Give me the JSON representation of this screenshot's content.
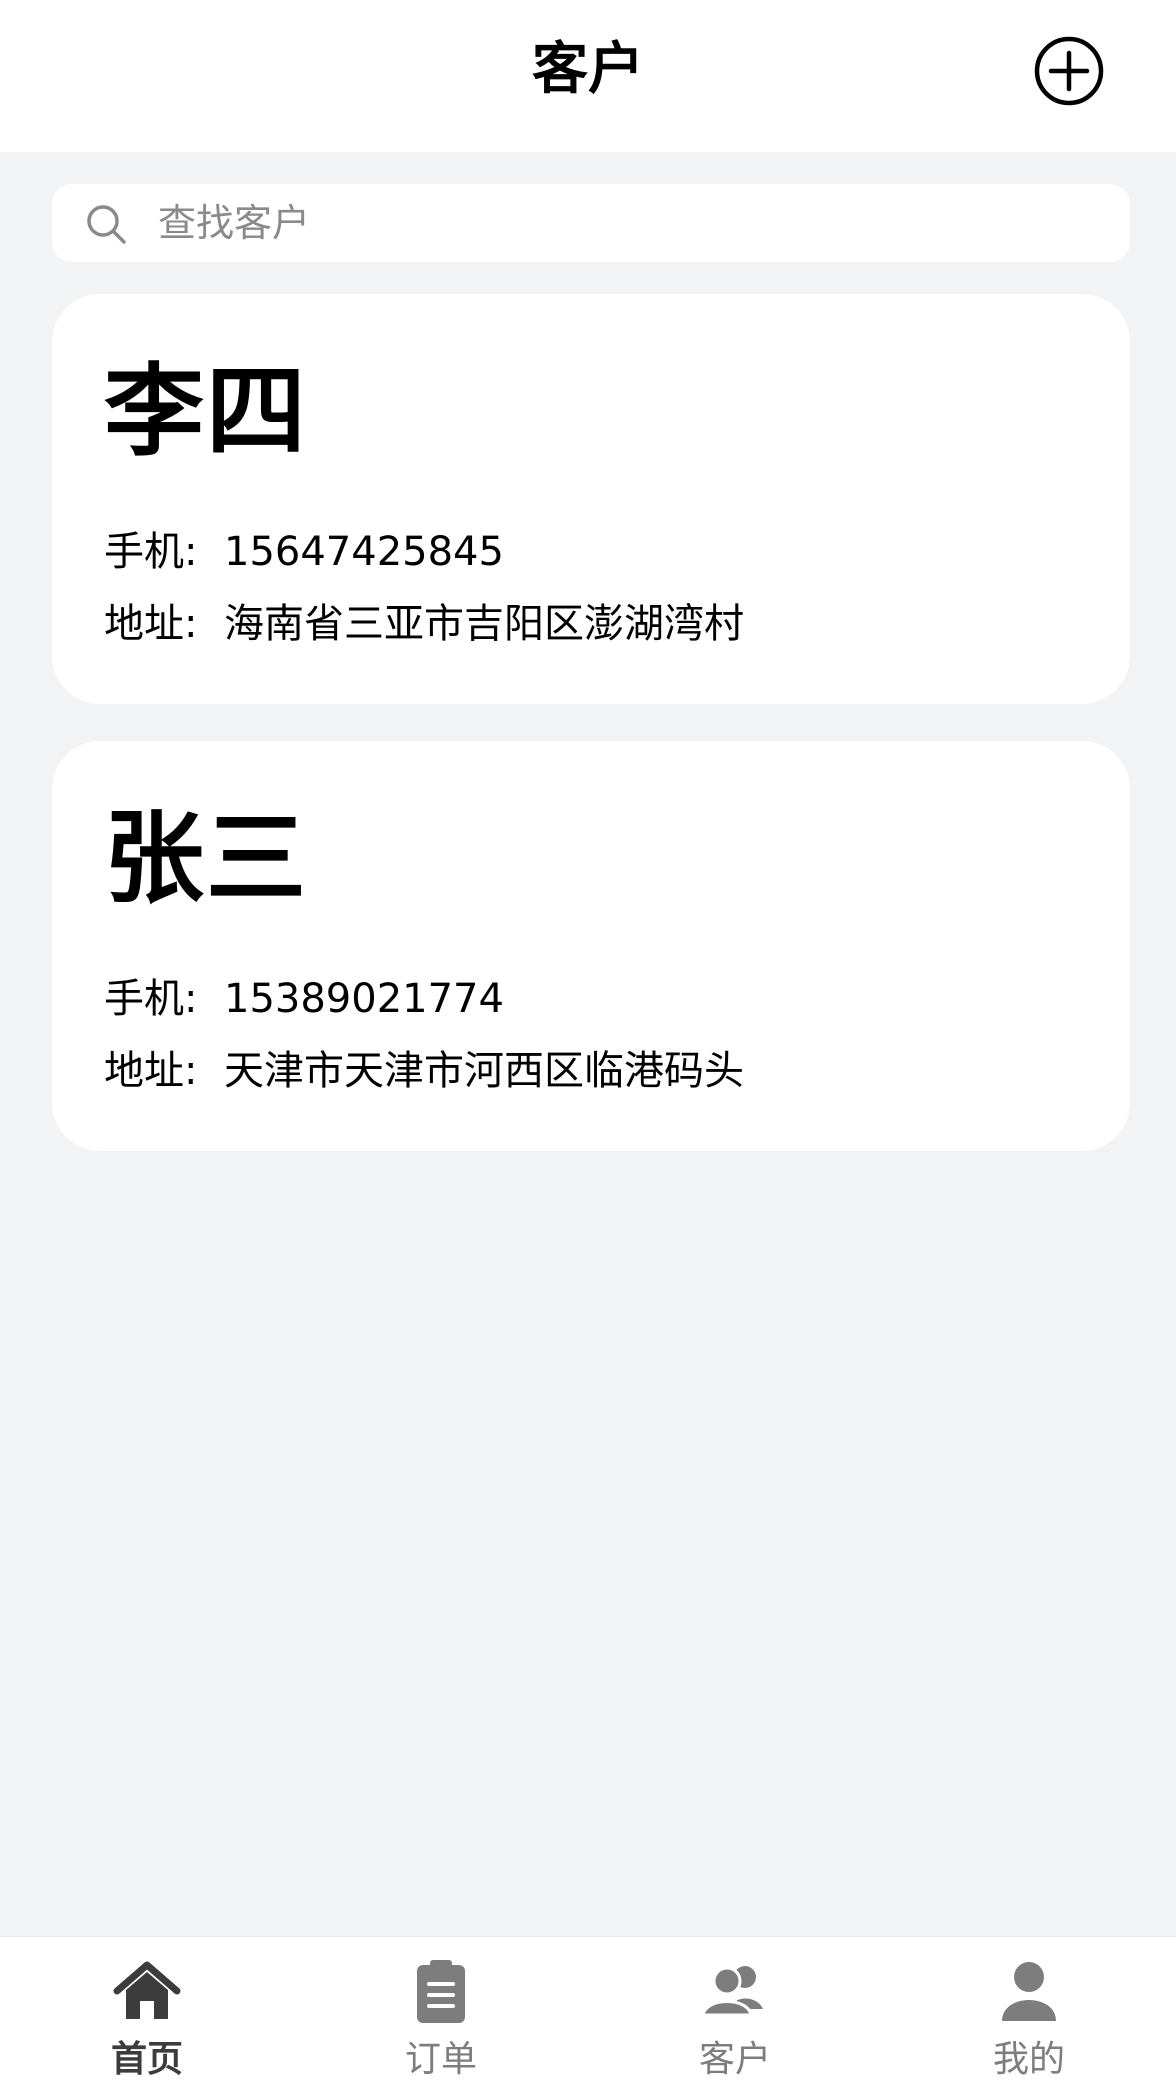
{
  "header": {
    "title": "客户",
    "add_icon": "plus-circle-icon"
  },
  "search": {
    "placeholder": "查找客户",
    "value": "",
    "icon": "search-icon"
  },
  "customers": [
    {
      "name": "李四",
      "phone_label": "手机:",
      "phone": "15647425845",
      "address_label": "地址:",
      "address": "海南省三亚市吉阳区澎湖湾村"
    },
    {
      "name": "张三",
      "phone_label": "手机:",
      "phone": "15389021774",
      "address_label": "地址:",
      "address": "天津市天津市河西区临港码头"
    }
  ],
  "tabbar": {
    "active_index": 0,
    "items": [
      {
        "label": "首页",
        "icon": "home-icon"
      },
      {
        "label": "订单",
        "icon": "clipboard-icon"
      },
      {
        "label": "客户",
        "icon": "users-icon"
      },
      {
        "label": "我的",
        "icon": "user-icon"
      }
    ]
  },
  "colors": {
    "background": "#f2f3f5",
    "card": "#ffffff",
    "tab_active": "#3c3c3c",
    "tab_inactive": "#7d7d7d"
  }
}
